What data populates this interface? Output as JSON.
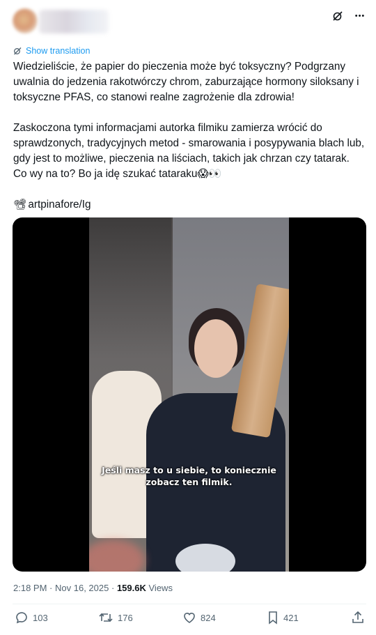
{
  "header": {
    "icons": [
      "grok-icon",
      "more-icon"
    ],
    "more_glyph": "•••"
  },
  "post": {
    "show_translation": "Show translation",
    "paragraph1": "Wiedzieliście, że papier do pieczenia może być toksyczny? Podgrzany uwalnia do jedzenia rakotwórczy chrom, zaburzające hormony siloksany i toksyczne PFAS, co stanowi realne zagrożenie dla zdrowia!",
    "paragraph2": "Zaskoczona tymi informacjami autorka filmiku zamierza wrócić do sprawdzonych, tradycyjnych metod - smarowania i posypywania blach lub, gdy jest to możliwe, pieczenia na liściach, takich jak chrzan czy tatarak. Co wy na to? Bo ja idę szukać tataraku😱👀",
    "credit_emoji": "📽",
    "credit": "artpinafore/Ig"
  },
  "video": {
    "caption": "Jeśli masz to u siebie, to koniecznie zobacz ten filmik."
  },
  "meta": {
    "time": "2:18 PM",
    "separator": "·",
    "date": "Nov 16, 2025",
    "views_count": "159.6K",
    "views_label": "Views"
  },
  "actions": {
    "replies": "103",
    "reposts": "176",
    "likes": "824",
    "bookmarks": "421"
  },
  "colors": {
    "accent": "#1d9bf0",
    "text": "#0f1419",
    "secondary": "#536471"
  }
}
